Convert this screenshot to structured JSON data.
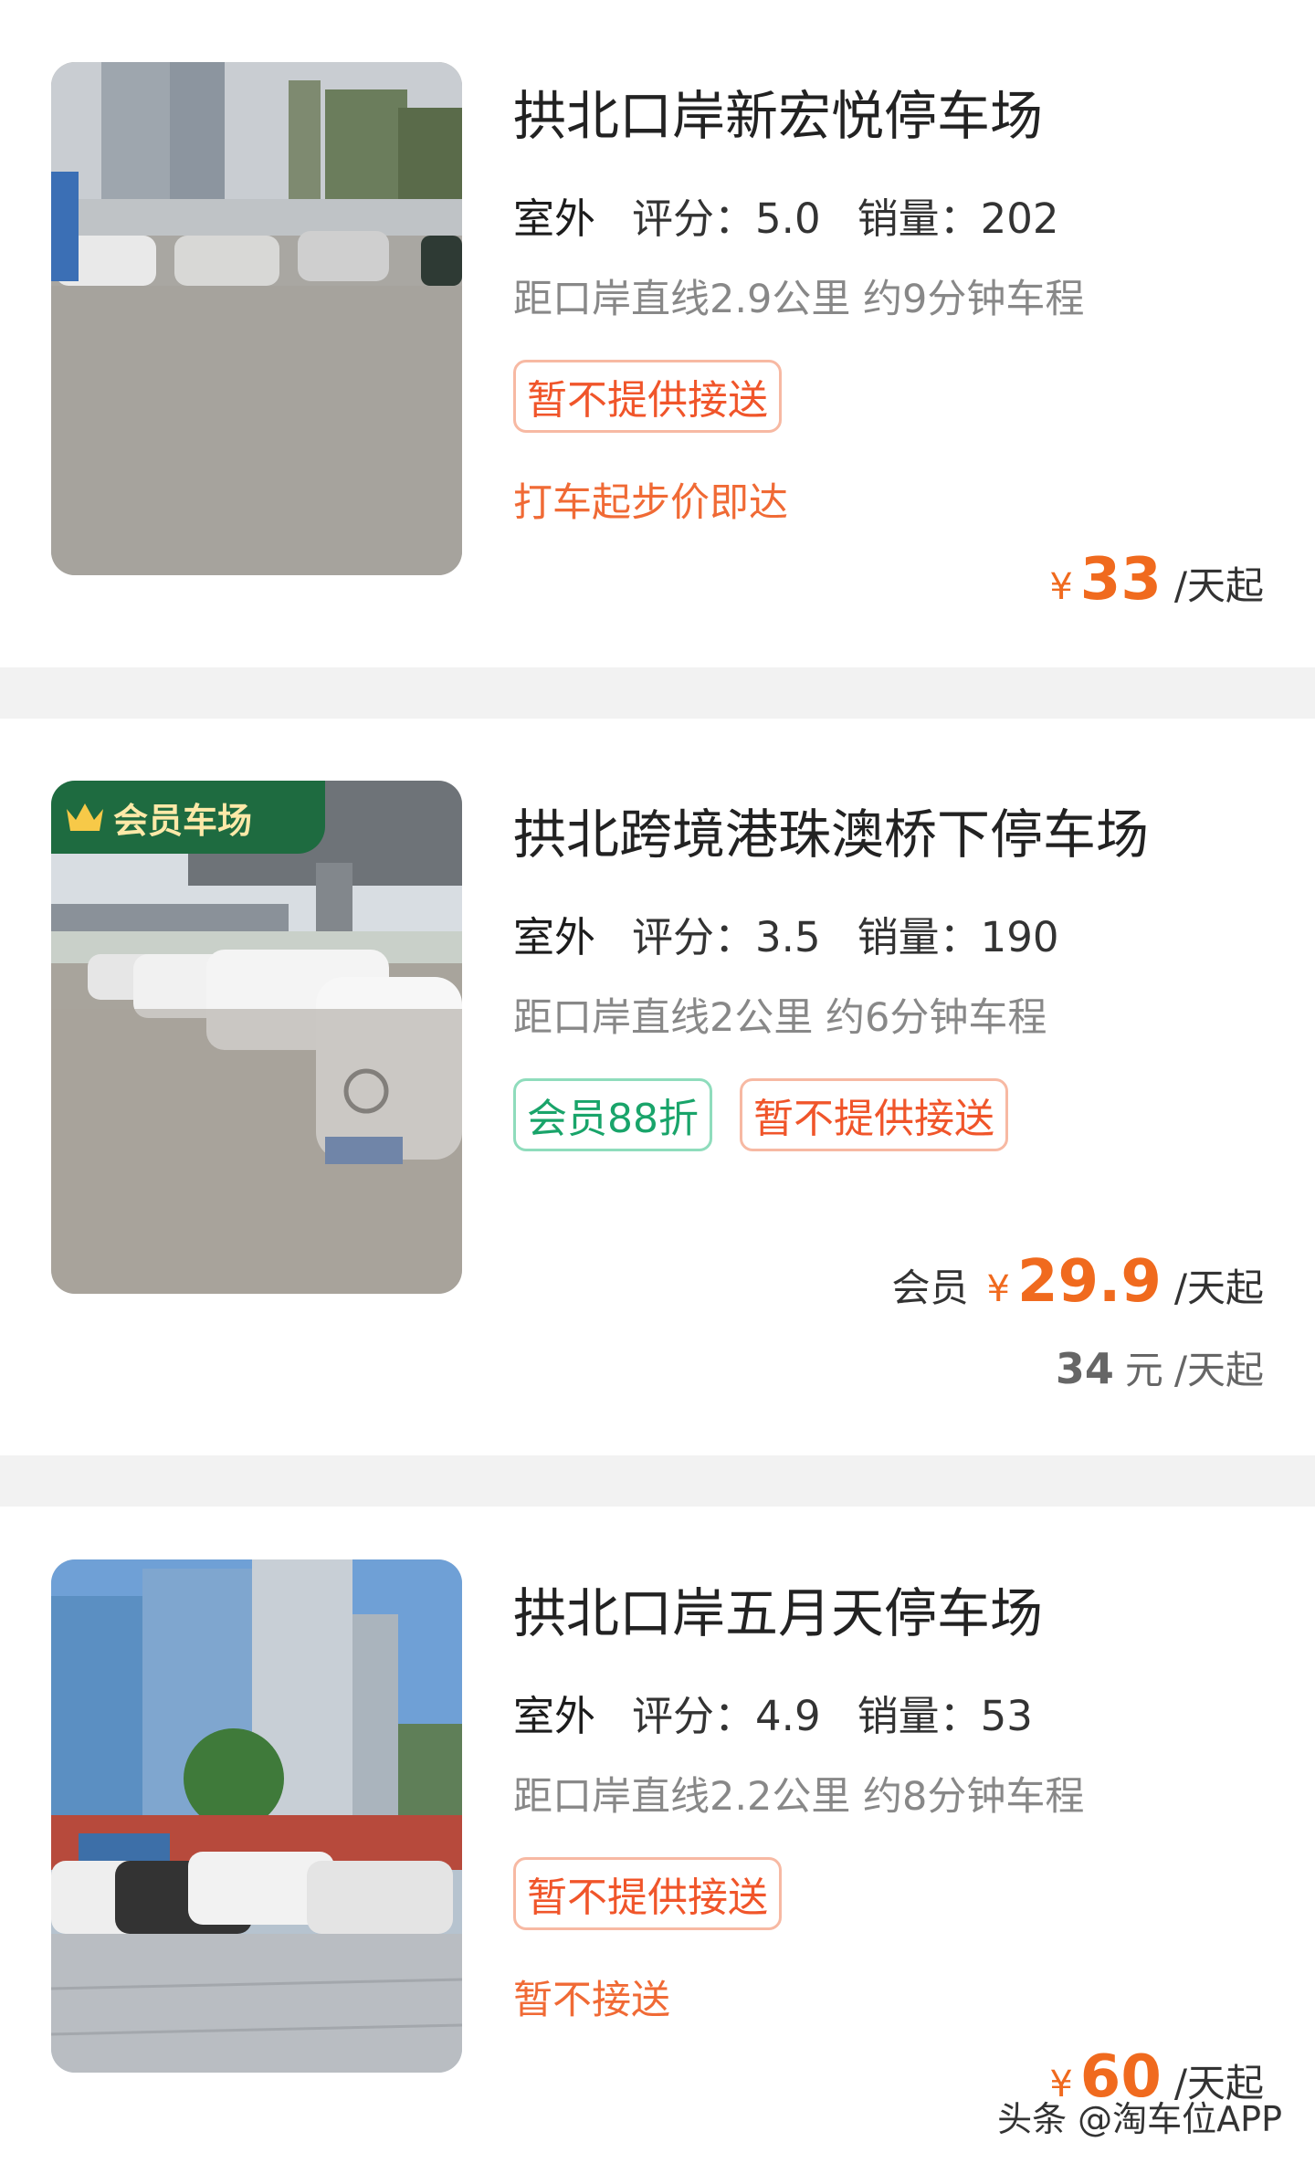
{
  "lots": [
    {
      "title": "拱北口岸新宏悦停车场",
      "type": "室外",
      "rating": "评分：5.0",
      "sales": "销量：202",
      "distance": "距口岸直线2.9公里 约9分钟车程",
      "tags": [
        "暂不提供接送"
      ],
      "note": "打车起步价即达",
      "price": {
        "currency": "¥",
        "value": "33",
        "unit": "/天起"
      }
    },
    {
      "badge": "会员车场",
      "title": "拱北跨境港珠澳桥下停车场",
      "type": "室外",
      "rating": "评分：3.5",
      "sales": "销量：190",
      "distance": "距口岸直线2公里 约6分钟车程",
      "tags": [
        "会员88折",
        "暂不提供接送"
      ],
      "price": {
        "label": "会员",
        "currency": "¥",
        "value": "29.9",
        "unit": "/天起"
      },
      "original_price": {
        "value": "34",
        "yuan": "元",
        "unit": "/天起"
      }
    },
    {
      "title": "拱北口岸五月天停车场",
      "type": "室外",
      "rating": "评分：4.9",
      "sales": "销量：53",
      "distance": "距口岸直线2.2公里 约8分钟车程",
      "tags": [
        "暂不提供接送"
      ],
      "note": "暂不接送",
      "price": {
        "currency": "¥",
        "value": "60",
        "unit": "/天起"
      }
    }
  ],
  "watermark": "头条 @淘车位APP",
  "colors": {
    "accent": "#f06a1e",
    "tag_orange": "#f0552a",
    "tag_green": "#19a46a",
    "member_flag": "#1e6b40"
  }
}
